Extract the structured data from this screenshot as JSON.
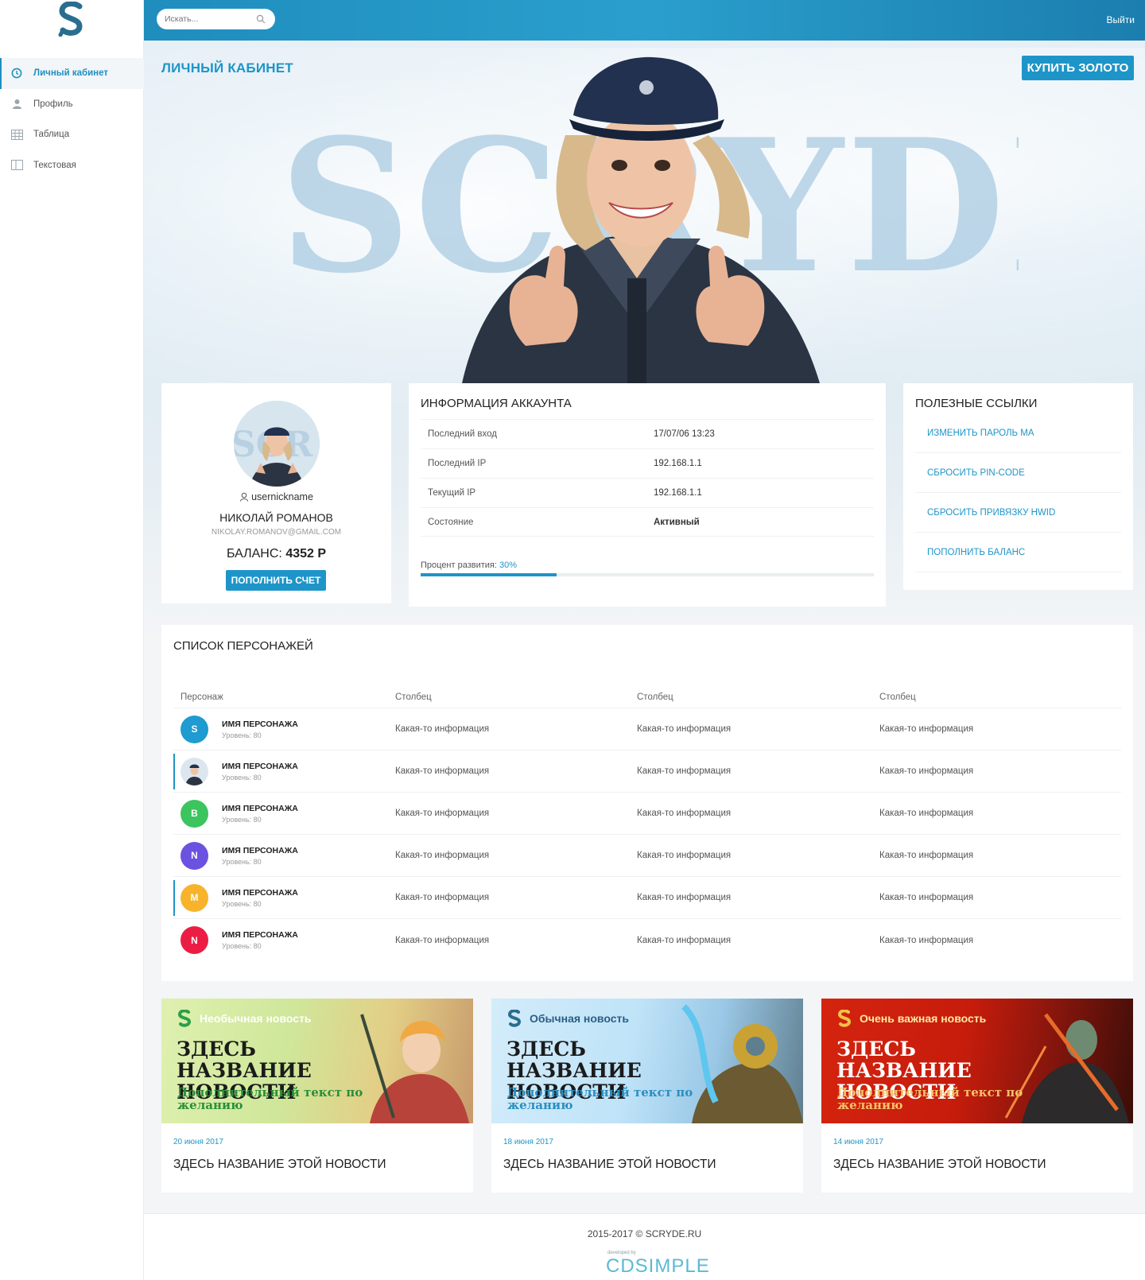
{
  "sidebar": {
    "items": [
      {
        "label": "Личный кабинет"
      },
      {
        "label": "Профиль"
      },
      {
        "label": "Таблица"
      },
      {
        "label": "Текстовая"
      }
    ]
  },
  "topbar": {
    "search_placeholder": "Искать...",
    "logout_label": "Выйти"
  },
  "hero": {
    "page_title": "ЛИЧНЫЙ КАБИНЕТ",
    "buy_gold_label": "КУПИТЬ ЗОЛОТО",
    "wordmark": "SCRYDE"
  },
  "profile": {
    "nickname": "usernickname",
    "full_name": "НИКОЛАЙ РОМАНОВ",
    "email": "NIKOLAY.ROMANOV@GMAIL.COM",
    "balance_label": "БАЛАНС:",
    "balance_value": "4352 Р",
    "topup_label": "ПОПОЛНИТЬ СЧЕТ"
  },
  "account_info": {
    "title": "ИНФОРМАЦИЯ АККАУНТА",
    "rows": [
      {
        "key": "Последний вход",
        "value": "17/07/06 13:23"
      },
      {
        "key": "Последний IP",
        "value": "192.168.1.1"
      },
      {
        "key": "Текущий IP",
        "value": "192.168.1.1"
      },
      {
        "key": "Состояние",
        "value": "Активный"
      }
    ],
    "progress_label": "Процент развития:",
    "progress_value": "30%",
    "progress_fraction": 0.3
  },
  "useful_links": {
    "title": "ПОЛЕЗНЫЕ ССЫЛКИ",
    "items": [
      {
        "label": "ИЗМЕНИТЬ ПАРОЛЬ МА"
      },
      {
        "label": "СБРОСИТЬ PIN-CODE"
      },
      {
        "label": "СБРОСИТЬ ПРИВЯЗКУ HWID"
      },
      {
        "label": "ПОПОЛНИТЬ БАЛАНС"
      }
    ]
  },
  "characters": {
    "title": "СПИСОК ПЕРСОНАЖЕЙ",
    "columns": [
      "Персонаж",
      "Столбец",
      "Столбец",
      "Столбец"
    ],
    "rows": [
      {
        "initial": "S",
        "color": "#1e9bd0",
        "name": "ИМЯ ПЕРСОНАЖА",
        "level": "Уровень: 80",
        "c2": "Какая-то информация",
        "c3": "Какая-то информация",
        "c4": "Какая-то информация"
      },
      {
        "initial": "",
        "color": "#dce6ee",
        "name": "ИМЯ ПЕРСОНАЖА",
        "level": "Уровень: 80",
        "c2": "Какая-то информация",
        "c3": "Какая-то информация",
        "c4": "Какая-то информация"
      },
      {
        "initial": "B",
        "color": "#3cc45e",
        "name": "ИМЯ ПЕРСОНАЖА",
        "level": "Уровень: 80",
        "c2": "Какая-то информация",
        "c3": "Какая-то информация",
        "c4": "Какая-то информация"
      },
      {
        "initial": "N",
        "color": "#6b52e0",
        "name": "ИМЯ ПЕРСОНАЖА",
        "level": "Уровень: 80",
        "c2": "Какая-то информация",
        "c3": "Какая-то информация",
        "c4": "Какая-то информация"
      },
      {
        "initial": "M",
        "color": "#f7b32b",
        "name": "ИМЯ ПЕРСОНАЖА",
        "level": "Уровень: 80",
        "c2": "Какая-то информация",
        "c3": "Какая-то информация",
        "c4": "Какая-то информация"
      },
      {
        "initial": "N",
        "color": "#ec1d44",
        "name": "ИМЯ ПЕРСОНАЖА",
        "level": "Уровень: 80",
        "c2": "Какая-то информация",
        "c3": "Какая-то информация",
        "c4": "Какая-то информация"
      }
    ]
  },
  "news": [
    {
      "tag": "Необычная новость",
      "banner_title": "ЗДЕСЬ НАЗВАНИЕ НОВОСТИ",
      "banner_sub": "Дополнительный текст по желанию",
      "date": "20 июня 2017",
      "title": "ЗДЕСЬ НАЗВАНИЕ ЭТОЙ НОВОСТИ"
    },
    {
      "tag": "Обычная новость",
      "banner_title": "ЗДЕСЬ НАЗВАНИЕ НОВОСТИ",
      "banner_sub": "Дополнительный текст по желанию",
      "date": "18 июня 2017",
      "title": "ЗДЕСЬ НАЗВАНИЕ ЭТОЙ НОВОСТИ"
    },
    {
      "tag": "Очень важная новость",
      "banner_title": "ЗДЕСЬ НАЗВАНИЕ НОВОСТИ",
      "banner_sub": "Дополнительный текст по желанию",
      "date": "14 июня 2017",
      "title": "ЗДЕСЬ НАЗВАНИЕ ЭТОЙ НОВОСТИ"
    }
  ],
  "footer": {
    "copyright": "2015-2017 © SCRYDE.RU",
    "developed_by": "developed by",
    "developer": "CDSIMPLE"
  },
  "colors": {
    "accent": "#1e95c8",
    "topbar": "#2a9fcd"
  },
  "icons": [
    "logo-s-icon",
    "dashboard-icon",
    "user-icon",
    "table-icon",
    "columns-icon",
    "search-icon"
  ]
}
